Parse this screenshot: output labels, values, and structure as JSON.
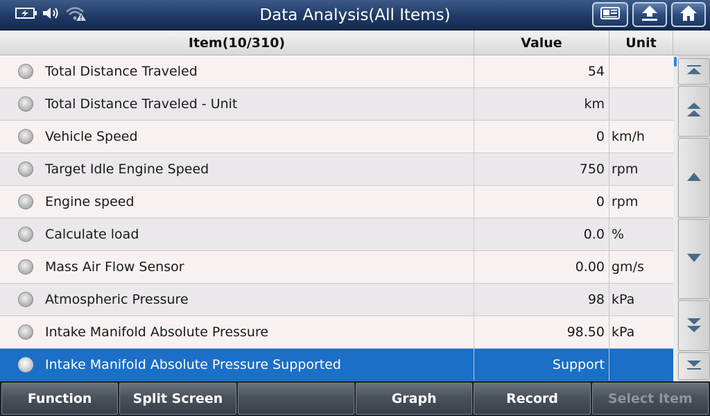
{
  "window": {
    "title": "Data Analysis(All Items)"
  },
  "status_icons": [
    "battery-charging-icon",
    "speaker-icon",
    "wifi-warning-icon"
  ],
  "nav_buttons": [
    "screenshot-icon",
    "back-arrow-icon",
    "home-icon"
  ],
  "table": {
    "headers": {
      "item": "Item(10/310)",
      "value": "Value",
      "unit": "Unit"
    },
    "rows": [
      {
        "item": "Total Distance Traveled",
        "value": "54",
        "unit": ""
      },
      {
        "item": "Total Distance Traveled - Unit",
        "value": "km",
        "unit": ""
      },
      {
        "item": "Vehicle Speed",
        "value": "0",
        "unit": "km/h"
      },
      {
        "item": "Target Idle Engine Speed",
        "value": "750",
        "unit": "rpm"
      },
      {
        "item": "Engine speed",
        "value": "0",
        "unit": "rpm"
      },
      {
        "item": "Calculate load",
        "value": "0.0",
        "unit": "%"
      },
      {
        "item": "Mass Air Flow Sensor",
        "value": "0.00",
        "unit": "gm/s"
      },
      {
        "item": "Atmospheric Pressure",
        "value": "98",
        "unit": "kPa"
      },
      {
        "item": "Intake Manifold Absolute Pressure",
        "value": "98.50",
        "unit": "kPa"
      },
      {
        "item": "Intake Manifold Absolute Pressure Supported",
        "value": "Support",
        "unit": ""
      }
    ],
    "selected_row": 9
  },
  "scroll_buttons": [
    "scroll-top-icon",
    "page-up-icon",
    "line-up-icon",
    "line-down-icon",
    "page-down-icon",
    "scroll-bottom-icon"
  ],
  "toolbar": {
    "function": "Function",
    "split_screen": "Split Screen",
    "blank": "",
    "graph": "Graph",
    "record": "Record",
    "select_item": "Select Item"
  },
  "colors": {
    "title_bar": "#1f3a66",
    "selected_row": "#1b6fc6",
    "toolbar": "#4a525c"
  }
}
